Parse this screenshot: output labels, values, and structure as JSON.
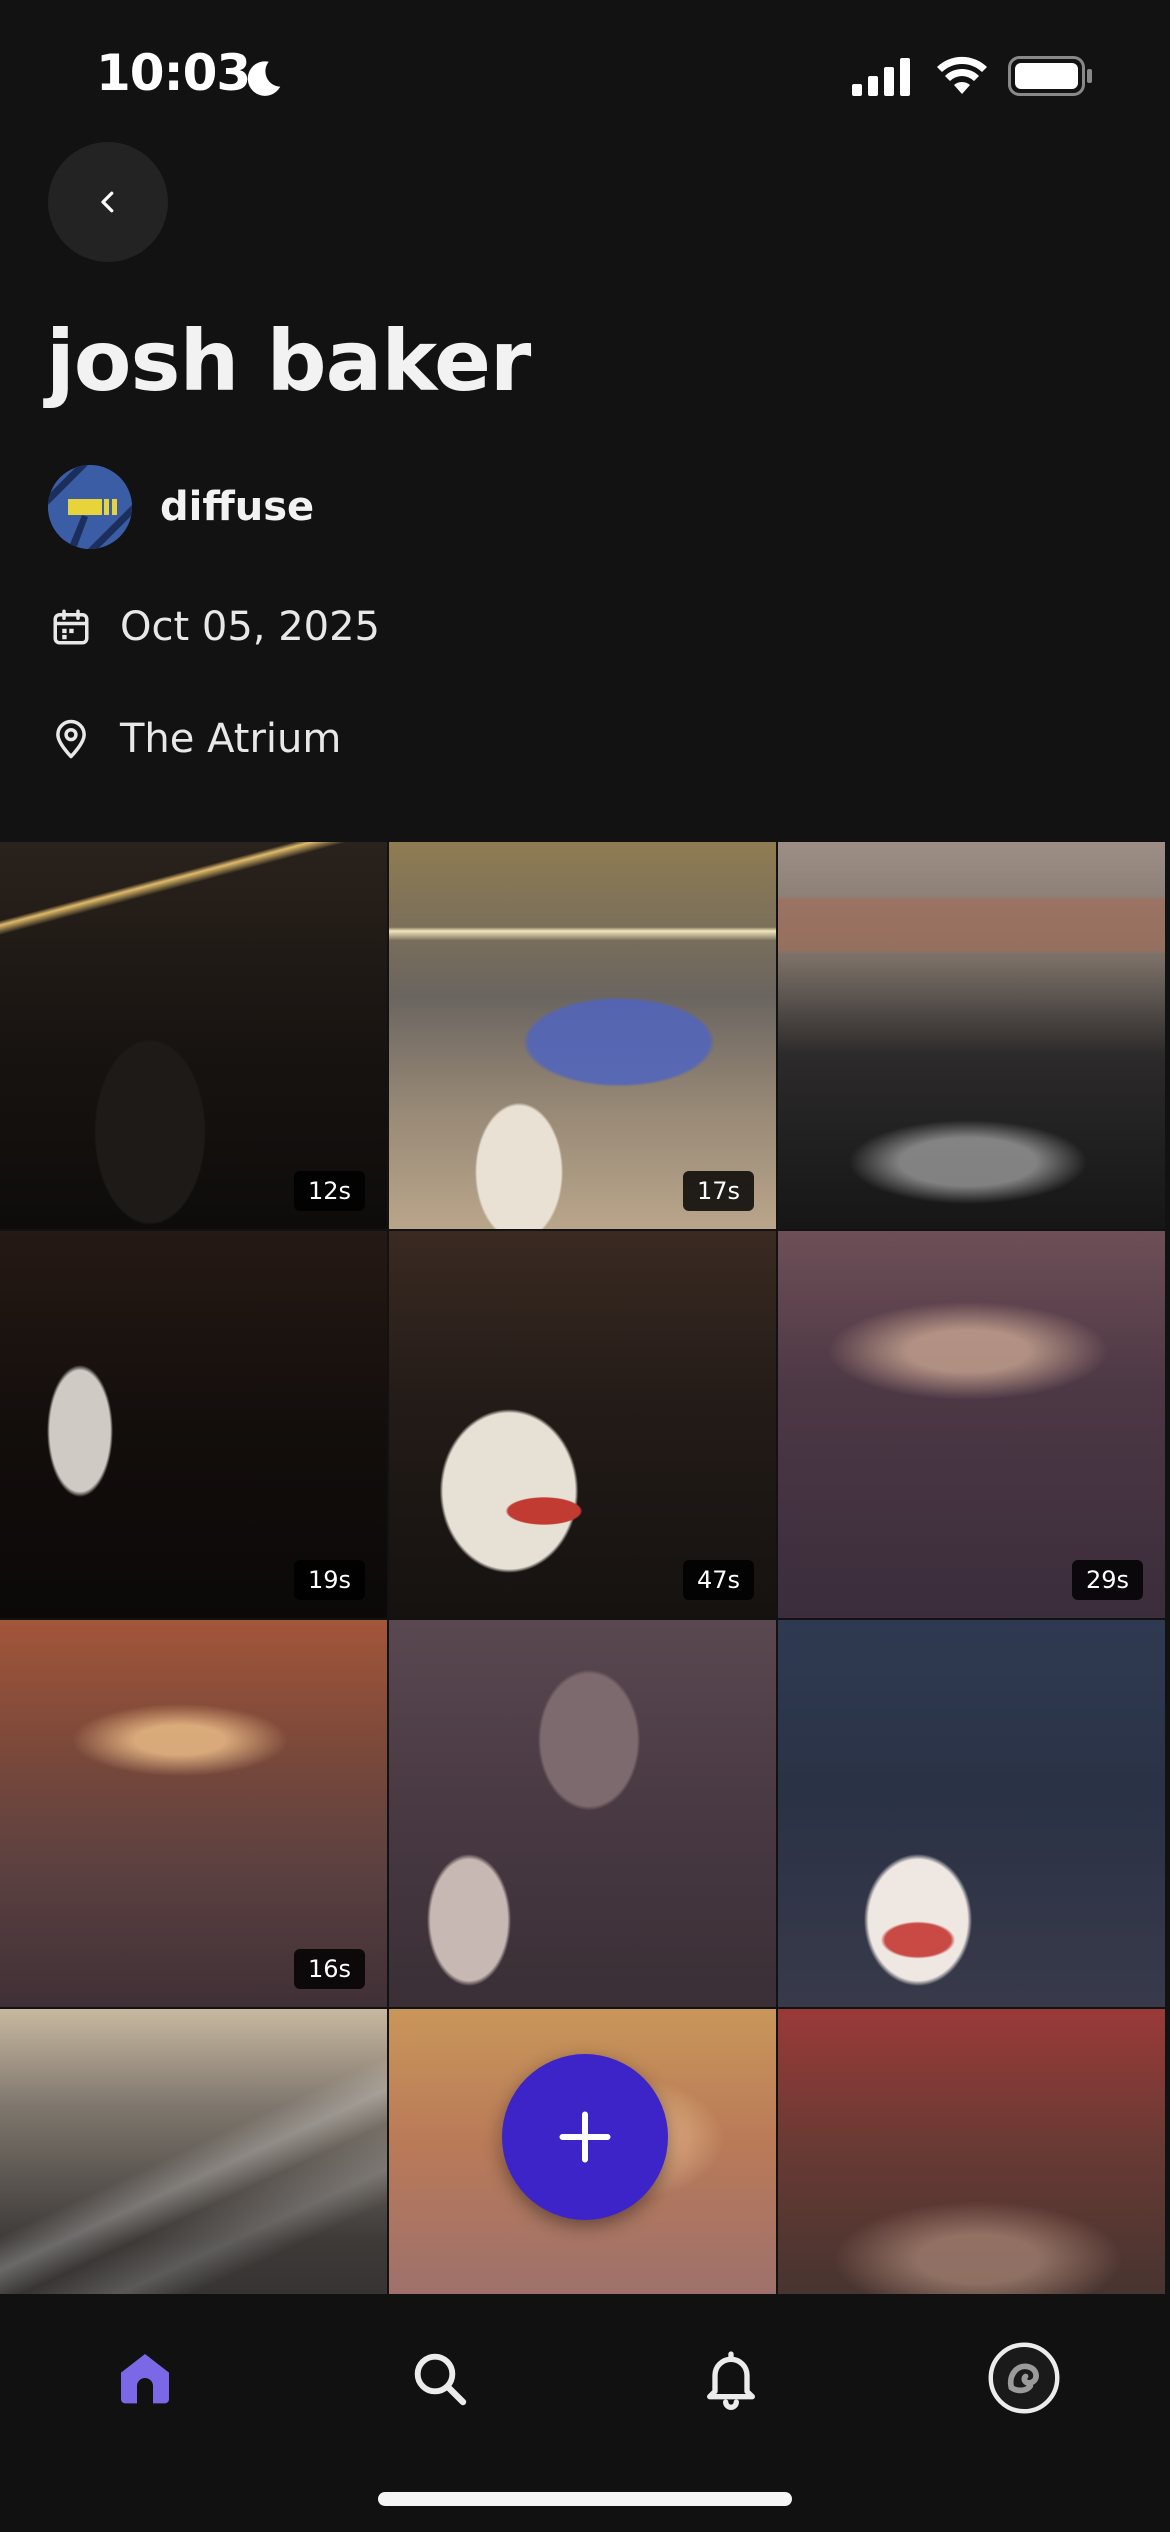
{
  "status_bar": {
    "time": "10:03"
  },
  "header": {
    "title": "josh baker"
  },
  "organizer": {
    "name": "diffuse"
  },
  "event": {
    "date": "Oct 05, 2025",
    "venue": "The Atrium"
  },
  "media": [
    {
      "duration": "12s",
      "kind": "video"
    },
    {
      "duration": "17s",
      "kind": "video"
    },
    {
      "duration": "",
      "kind": "photo"
    },
    {
      "duration": "19s",
      "kind": "video"
    },
    {
      "duration": "47s",
      "kind": "video"
    },
    {
      "duration": "29s",
      "kind": "video"
    },
    {
      "duration": "16s",
      "kind": "video"
    },
    {
      "duration": "",
      "kind": "photo"
    },
    {
      "duration": "",
      "kind": "photo"
    },
    {
      "duration": "",
      "kind": "photo"
    },
    {
      "duration": "",
      "kind": "photo"
    },
    {
      "duration": "",
      "kind": "photo"
    }
  ],
  "tab_bar": {
    "active": "home",
    "tabs": [
      "home-icon",
      "search-icon",
      "bell-icon",
      "profile-icon"
    ]
  },
  "colors": {
    "background": "#121212",
    "accent": "#3d24c9",
    "active_tab": "#7b68e6"
  }
}
